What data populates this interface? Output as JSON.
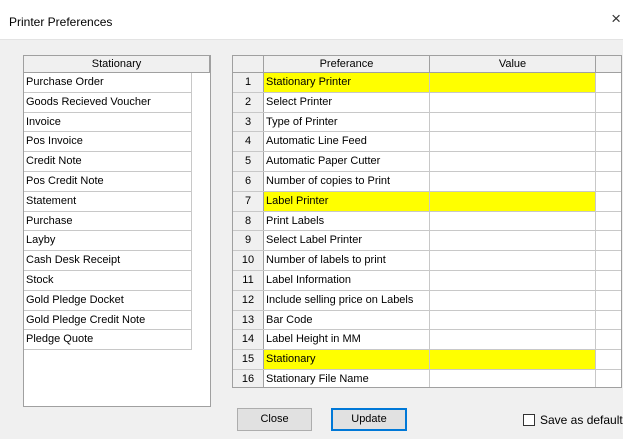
{
  "window": {
    "title": "Printer Preferences",
    "close_glyph": "×"
  },
  "stationary": {
    "header": "Stationary",
    "items": [
      "Purchase Order",
      "Goods Recieved Voucher",
      "Invoice",
      "Pos Invoice",
      "Credit Note",
      "Pos Credit Note",
      "Statement",
      "Purchase",
      "Layby",
      "Cash Desk Receipt",
      "Stock",
      "Gold Pledge Docket",
      "Gold Pledge Credit Note",
      "Pledge Quote"
    ]
  },
  "preferences": {
    "columns": {
      "preference": "Preferance",
      "value": "Value"
    },
    "highlight_color": "#ffff00",
    "rows": [
      {
        "num": "1",
        "label": "Stationary Printer",
        "value": "",
        "highlight": true
      },
      {
        "num": "2",
        "label": "Select Printer",
        "value": "",
        "highlight": false
      },
      {
        "num": "3",
        "label": "Type of Printer",
        "value": "",
        "highlight": false
      },
      {
        "num": "4",
        "label": "Automatic Line Feed",
        "value": "",
        "highlight": false
      },
      {
        "num": "5",
        "label": "Automatic Paper Cutter",
        "value": "",
        "highlight": false
      },
      {
        "num": "6",
        "label": "Number of copies to Print",
        "value": "",
        "highlight": false
      },
      {
        "num": "7",
        "label": "Label Printer",
        "value": "",
        "highlight": true
      },
      {
        "num": "8",
        "label": "Print Labels",
        "value": "",
        "highlight": false
      },
      {
        "num": "9",
        "label": "Select Label Printer",
        "value": "",
        "highlight": false
      },
      {
        "num": "10",
        "label": "Number of labels to print",
        "value": "",
        "highlight": false
      },
      {
        "num": "11",
        "label": "Label Information",
        "value": "",
        "highlight": false
      },
      {
        "num": "12",
        "label": "Include selling price on Labels",
        "value": "",
        "highlight": false
      },
      {
        "num": "13",
        "label": "Bar Code",
        "value": "",
        "highlight": false
      },
      {
        "num": "14",
        "label": "Label Height in MM",
        "value": "",
        "highlight": false
      },
      {
        "num": "15",
        "label": "Stationary",
        "value": "",
        "highlight": true
      },
      {
        "num": "16",
        "label": "Stationary File Name",
        "value": "",
        "highlight": false
      }
    ]
  },
  "buttons": {
    "close": "Close",
    "update": "Update"
  },
  "save_default": {
    "label": "Save as default",
    "checked": false
  }
}
